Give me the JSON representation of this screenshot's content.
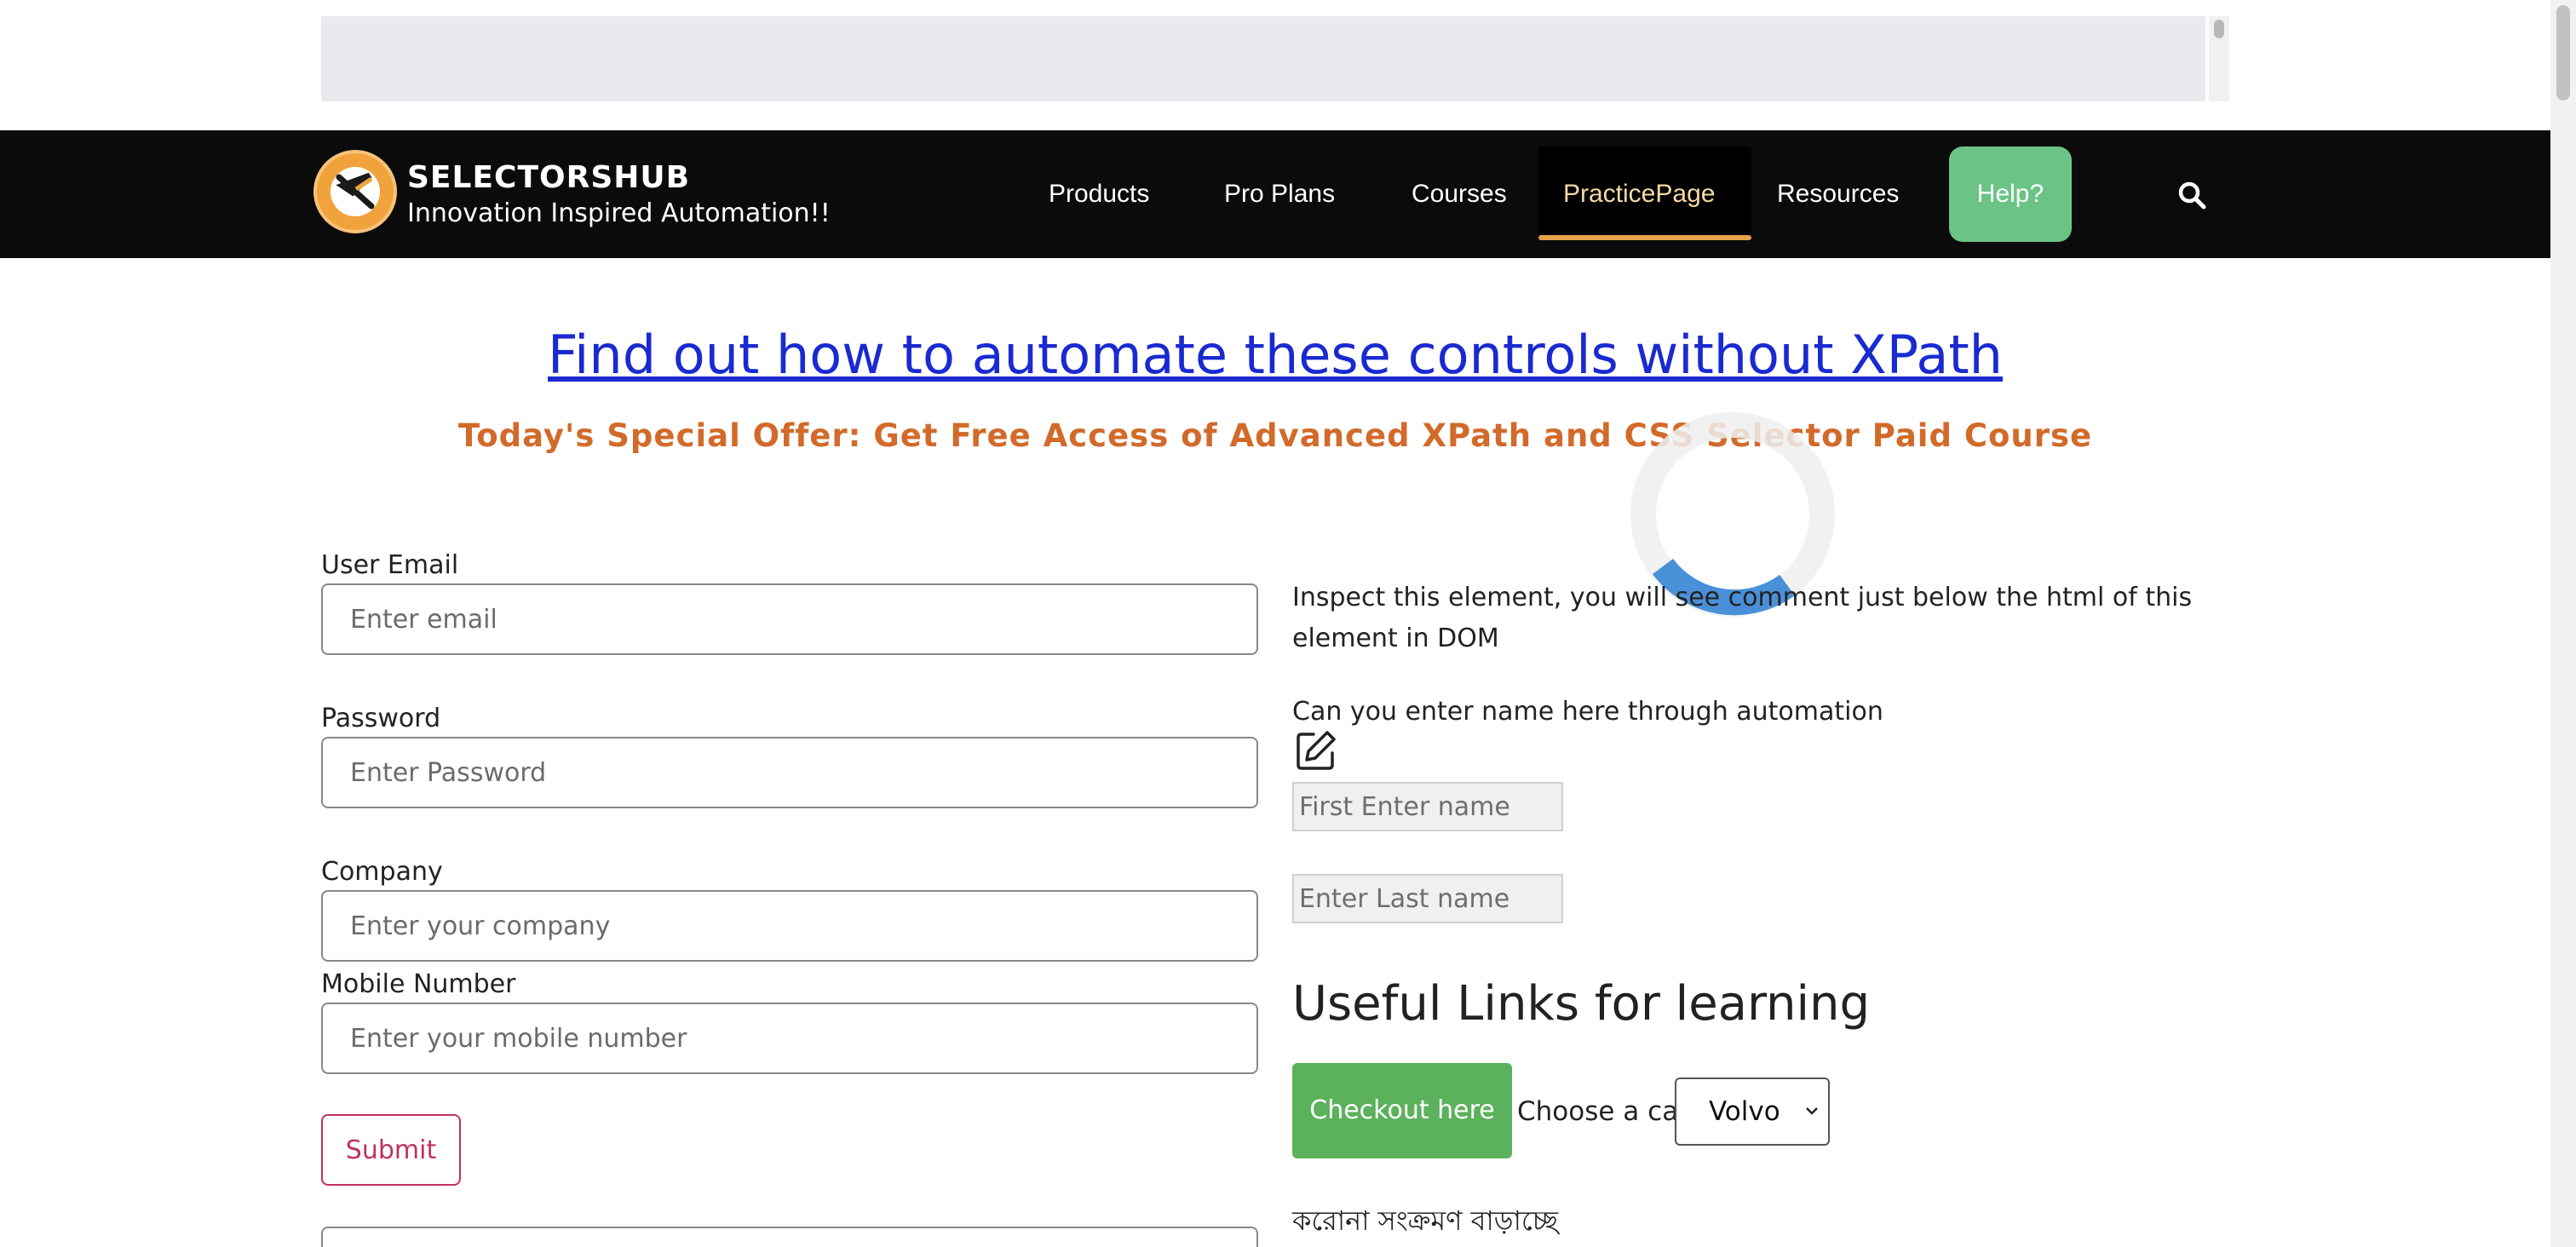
{
  "nav": {
    "brand_title": "SELECTORSHUB",
    "brand_tagline": "Innovation Inspired Automation!!",
    "items": [
      "Products",
      "Pro Plans",
      "Courses",
      "PracticePage",
      "Resources"
    ],
    "help_label": "Help?",
    "active_item": "PracticePage",
    "accent_color": "#e5a24a",
    "help_color": "#6cc386"
  },
  "main": {
    "heading": "Find out how to automate these controls without XPath",
    "offer": "Today's Special Offer: Get Free Access of Advanced XPath and CSS Selector Paid Course"
  },
  "form": {
    "email_label": "User Email",
    "email_placeholder": "Enter email",
    "password_label": "Password",
    "password_placeholder": "Enter Password",
    "company_label": "Company",
    "company_placeholder": "Enter your company",
    "mobile_label": "Mobile Number",
    "mobile_placeholder": "Enter your mobile number",
    "submit_label": "Submit"
  },
  "right": {
    "inspect_text": "Inspect this element, you will see comment just below the html of this element in DOM",
    "ask_text": "Can you enter name here through automation",
    "first_name_placeholder": "First Enter name",
    "last_name_placeholder": "Enter Last name",
    "links_heading": "Useful Links for learning",
    "checkout_label": "Checkout here",
    "car_label": "Choose a car:",
    "car_selected": "Volvo",
    "bengali_text": "করোনা সংক্রমণ বাড়াচ্ছে"
  },
  "icons": {
    "search": "search-icon",
    "edit": "edit-icon",
    "logo": "selectorshub-logo",
    "spinner": "loading-spinner"
  }
}
